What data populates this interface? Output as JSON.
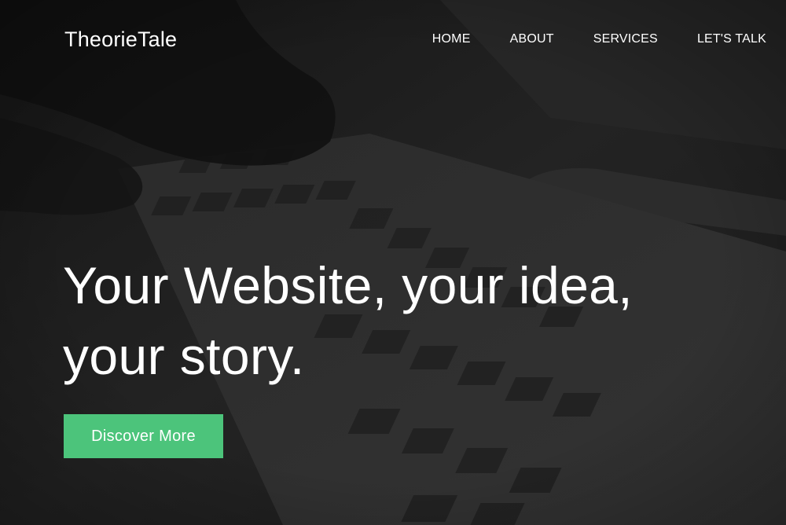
{
  "brand": {
    "name": "TheorieTale"
  },
  "nav": {
    "items": [
      {
        "label": "HOME"
      },
      {
        "label": "ABOUT"
      },
      {
        "label": "SERVICES"
      },
      {
        "label": "LET'S TALK"
      }
    ]
  },
  "hero": {
    "heading": "Your Website, your idea, your story.",
    "cta_label": "Discover More",
    "background": "dark-keyboard-photo"
  },
  "colors": {
    "accent": "#4cc47b",
    "overlay": "#1c1c1c",
    "text": "#ffffff"
  }
}
